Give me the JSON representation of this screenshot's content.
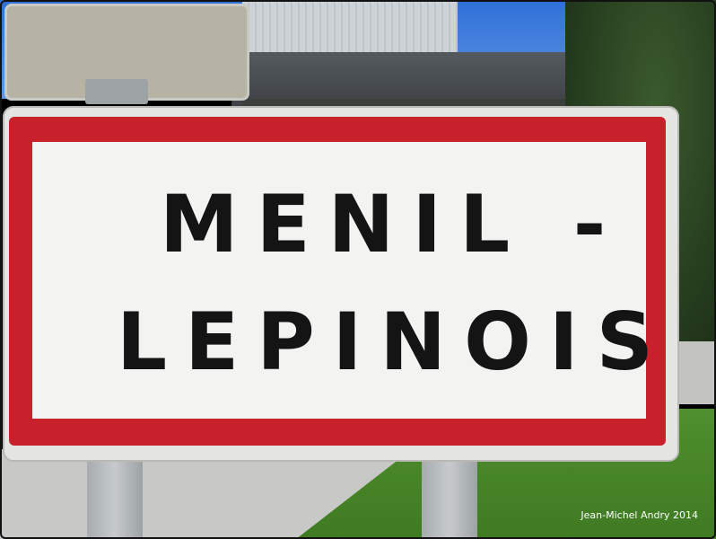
{
  "sign": {
    "line1": "MENIL -",
    "line2": "LEPINOIS",
    "border_color": "#c8212b",
    "background_color": "#f3f3f1",
    "text_color": "#141414"
  },
  "credit": "Jean-Michel Andry 2014"
}
